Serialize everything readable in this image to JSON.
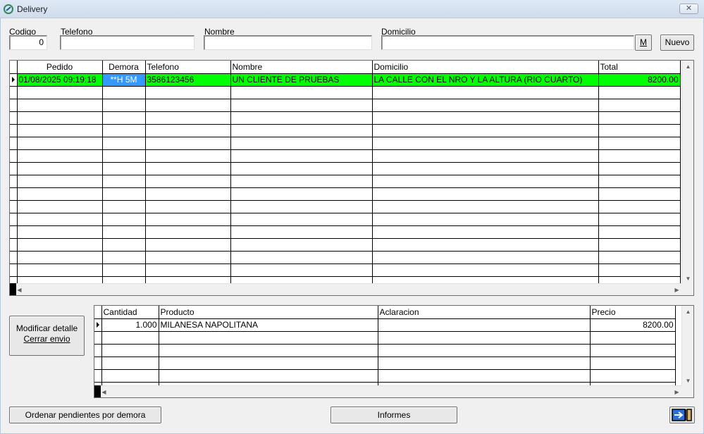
{
  "window": {
    "title": "Delivery"
  },
  "filters": {
    "codigo_label": "Codigo",
    "codigo_value": "0",
    "telefono_label": "Telefono",
    "telefono_value": "",
    "nombre_label": "Nombre",
    "nombre_value": "",
    "domicilio_label": "Domicilio",
    "domicilio_value": "",
    "m_button": "M",
    "nuevo_button": "Nuevo"
  },
  "orders": {
    "columns": [
      "Pedido",
      "Demora",
      "Telefono",
      "Nombre",
      "Domicilio",
      "Total"
    ],
    "rows": [
      {
        "pedido": "01/08/2025 09:19:18",
        "demora": "**H  5M",
        "telefono": "3586123456",
        "nombre": "UN CLIENTE DE PRUEBAS",
        "domicilio": "LA CALLE CON EL NRO Y LA ALTURA (RIO CUARTO)",
        "total": "8200.00"
      }
    ],
    "highlight_color": "#00ff00",
    "selected_color": "#3399ff"
  },
  "detail_button": {
    "line1": "Modificar detalle",
    "line2": "Cerrar envio"
  },
  "details": {
    "columns": [
      "Cantidad",
      "Producto",
      "Aclaracion",
      "Precio"
    ],
    "rows": [
      {
        "cantidad": "1.000",
        "producto": "MILANESA NAPOLITANA",
        "aclaracion": "",
        "precio": "8200.00"
      }
    ]
  },
  "bottom": {
    "ordenar_button": "Ordenar pendientes por demora",
    "informes_button": "Informes",
    "exit_icon": "exit-door-icon"
  }
}
